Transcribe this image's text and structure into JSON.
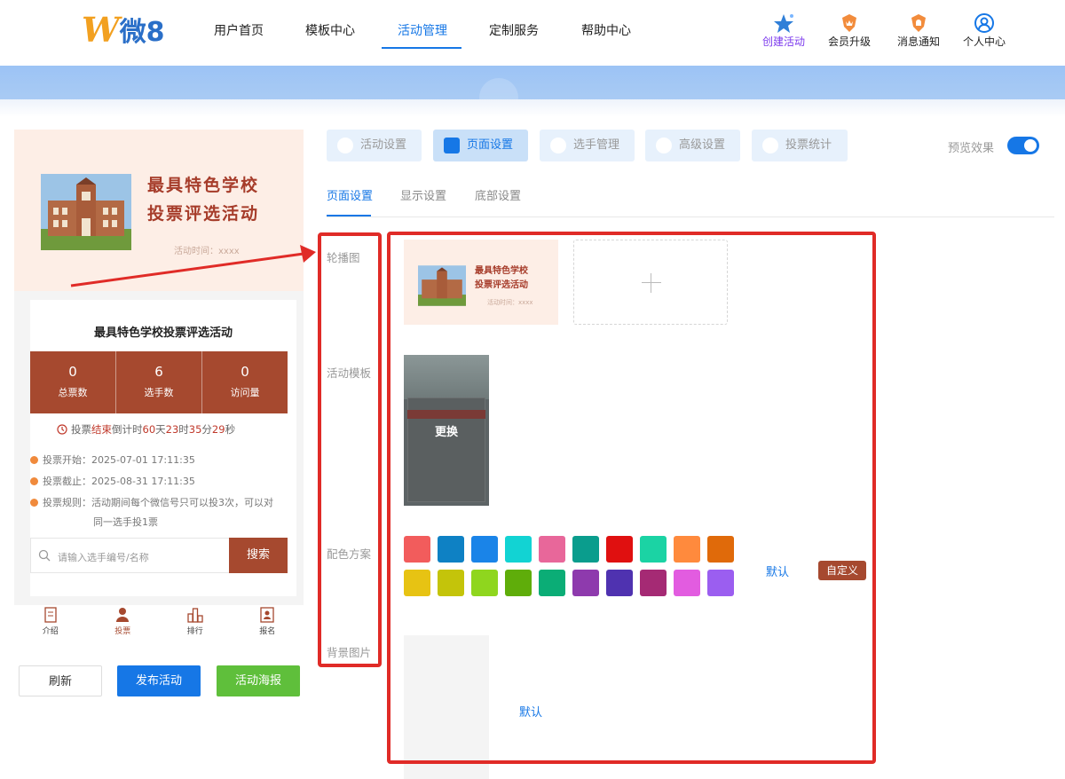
{
  "app": {
    "logo_text": "微8",
    "logo_letter": "W"
  },
  "nav": {
    "items": [
      "用户首页",
      "模板中心",
      "活动管理",
      "定制服务",
      "帮助中心"
    ],
    "active": "活动管理"
  },
  "tools": [
    {
      "label": "创建活动",
      "icon": "star-icon"
    },
    {
      "label": "会员升级",
      "icon": "crown-icon"
    },
    {
      "label": "消息通知",
      "icon": "bell-icon"
    },
    {
      "label": "个人中心",
      "icon": "user-icon"
    }
  ],
  "preview": {
    "poster_title_line1": "最具特色学校",
    "poster_title_line2": "投票评选活动",
    "poster_time": "活动时间：xxxx",
    "card_title": "最具特色学校投票评选活动",
    "stats": [
      {
        "value": "0",
        "label": "总票数"
      },
      {
        "value": "6",
        "label": "选手数"
      },
      {
        "value": "0",
        "label": "访问量"
      }
    ],
    "countdown": {
      "prefix": "投票",
      "status": "结束",
      "middle": "倒计时",
      "days": "60",
      "days_unit": "天",
      "hours": "23",
      "hours_unit": "时",
      "minutes": "35",
      "minutes_unit": "分",
      "seconds": "29",
      "seconds_unit": "秒"
    },
    "start_label": "投票开始：",
    "start_value": "2025-07-01 17:11:35",
    "end_label": "投票截止：",
    "end_value": "2025-08-31 17:11:35",
    "rule_label": "投票规则：",
    "rule_value_line1": "活动期间每个微信号只可以投3次，可以对",
    "rule_value_line2": "同一选手投1票",
    "search_placeholder": "请输入选手编号/名称",
    "search_button": "搜索",
    "tabbar": [
      "介绍",
      "投票",
      "排行",
      "报名"
    ],
    "tabbar_active": "投票"
  },
  "actions": {
    "refresh": "刷新",
    "publish": "发布活动",
    "poster": "活动海报"
  },
  "settings": {
    "top_tabs": [
      "活动设置",
      "页面设置",
      "选手管理",
      "高级设置",
      "投票统计"
    ],
    "top_tab_active": "页面设置",
    "preview_label": "预览效果",
    "preview_on": true,
    "sub_tabs": [
      "页面设置",
      "显示设置",
      "底部设置"
    ],
    "sub_tab_active": "页面设置",
    "rows": {
      "carousel": "轮播图",
      "template": "活动模板",
      "color_scheme": "配色方案",
      "background": "背景图片"
    },
    "thumb_title_line1": "最具特色学校",
    "thumb_title_line2": "投票评选活动",
    "thumb_time": "活动时间：xxxx",
    "template_change": "更换",
    "colors_row1": [
      "#f25c5c",
      "#0e81c4",
      "#1a84e8",
      "#12d3d3",
      "#e8679a",
      "#0a9d8d",
      "#e01010",
      "#1bd3a4",
      "#ff8a3d",
      "#e06a0a"
    ],
    "colors_row2": [
      "#e7c313",
      "#c4c40a",
      "#8fd61e",
      "#5fad0a",
      "#0bad76",
      "#8e3aad",
      "#4f32b0",
      "#a52a74",
      "#e25ce0",
      "#9b5ef0"
    ],
    "color_default": "默认",
    "color_custom": "自定义",
    "background_default": "默认"
  },
  "colors": {
    "accent": "#1677e6",
    "brand_red": "#a6492f",
    "highlight_box": "#e02b27",
    "publish_button": "#1677e6",
    "poster_button": "#5fbf3b"
  }
}
